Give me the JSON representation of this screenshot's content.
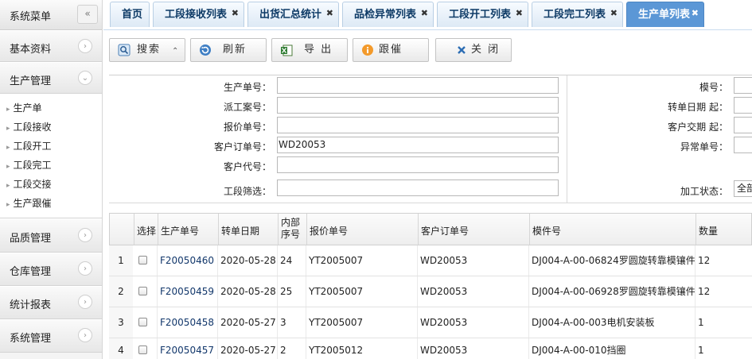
{
  "sidebar": {
    "title": "系统菜单",
    "collapse_glyph": "«",
    "sections_top": [
      {
        "label": "基本资料",
        "glyph": "›"
      },
      {
        "label": "生产管理",
        "glyph": "⌄"
      }
    ],
    "sub_items": [
      "生产单",
      "工段接收",
      "工段开工",
      "工段完工",
      "工段交接",
      "生产跟催"
    ],
    "sections_bottom": [
      {
        "label": "品质管理",
        "glyph": "›"
      },
      {
        "label": "仓库管理",
        "glyph": "›"
      },
      {
        "label": "统计报表",
        "glyph": "›"
      },
      {
        "label": "系统管理",
        "glyph": "›"
      }
    ]
  },
  "tabs": [
    {
      "label": "首页",
      "closable": false
    },
    {
      "label": "工段接收列表",
      "closable": true
    },
    {
      "label": "出货汇总统计",
      "closable": true
    },
    {
      "label": "品检异常列表",
      "closable": true
    },
    {
      "label": "工段开工列表",
      "closable": true
    },
    {
      "label": "工段完工列表",
      "closable": true
    },
    {
      "label": "生产单列表",
      "closable": true,
      "active": true
    }
  ],
  "toolbar": {
    "search": "搜索",
    "search_caret": "⌃",
    "refresh": "刷新",
    "export": "导 出",
    "follow": "跟催",
    "close": "关 闭"
  },
  "form": {
    "left": [
      {
        "label": "生产单号：",
        "value": ""
      },
      {
        "label": "派工案号：",
        "value": ""
      },
      {
        "label": "报价单号：",
        "value": ""
      },
      {
        "label": "客户订单号：",
        "value": "WD20053"
      },
      {
        "label": "客户代号：",
        "value": ""
      },
      {
        "label": "工段筛选：",
        "value": ""
      }
    ],
    "right": [
      {
        "label": "模号：",
        "value": ""
      },
      {
        "label": "转单日期 起：",
        "value": ""
      },
      {
        "label": "客户交期 起：",
        "value": ""
      },
      {
        "label": "异常单号：",
        "value": ""
      },
      {
        "label": "加工状态：",
        "value": "全部"
      }
    ]
  },
  "grid": {
    "headers": [
      "选择",
      "生产单号",
      "转单日期",
      "内部序号",
      "报价单号",
      "客户订单号",
      "模件号",
      "数量"
    ],
    "rows": [
      {
        "n": "1",
        "order": "F20050460",
        "date": "2020-05-28",
        "seq": "24",
        "quote": "YT2005007",
        "cust": "WD20053",
        "part": "DJ004-A-00-06824罗圆旋转靠模镶件",
        "qty": "12"
      },
      {
        "n": "2",
        "order": "F20050459",
        "date": "2020-05-28",
        "seq": "25",
        "quote": "YT2005007",
        "cust": "WD20053",
        "part": "DJ004-A-00-06928罗圆旋转靠模镶件",
        "qty": "12"
      },
      {
        "n": "3",
        "order": "F20050458",
        "date": "2020-05-27",
        "seq": "3",
        "quote": "YT2005007",
        "cust": "WD20053",
        "part": "DJ004-A-00-003电机安装板",
        "qty": "1"
      },
      {
        "n": "4",
        "order": "F20050457",
        "date": "2020-05-27",
        "seq": "2",
        "quote": "YT2005012",
        "cust": "WD20053",
        "part": "DJ004-A-00-010挡圈",
        "qty": "1"
      }
    ]
  },
  "colors": {
    "accent": "#5b97d6",
    "link": "#12376b"
  }
}
